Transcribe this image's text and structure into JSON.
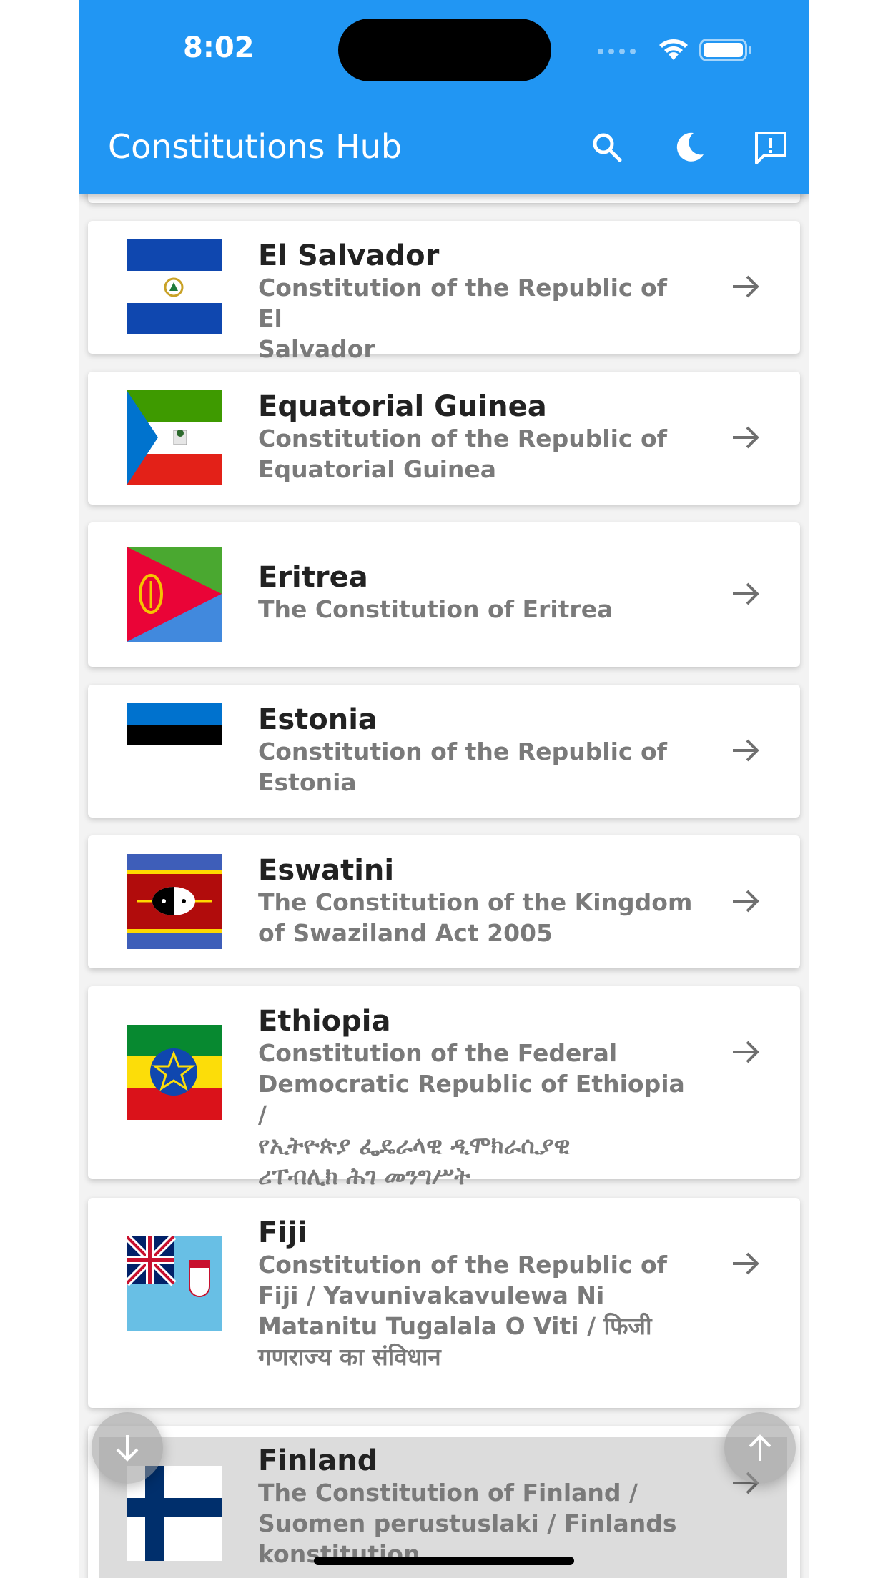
{
  "status": {
    "time": "8:02"
  },
  "appbar": {
    "title": "Constitutions Hub",
    "actions": [
      "search-icon",
      "moon-icon",
      "feedback-icon"
    ]
  },
  "colors": {
    "primary": "#2196f3",
    "card": "#ffffff",
    "subtitle": "#7a7a7a"
  },
  "countries": [
    {
      "name": "El Salvador",
      "lines": [
        "Constitution of the Republic of El",
        "Salvador"
      ]
    },
    {
      "name": "Equatorial Guinea",
      "lines": [
        "Constitution of the Republic of",
        "Equatorial Guinea"
      ]
    },
    {
      "name": "Eritrea",
      "lines": [
        "The Constitution of Eritrea"
      ]
    },
    {
      "name": "Estonia",
      "lines": [
        "Constitution of the Republic of",
        "Estonia"
      ]
    },
    {
      "name": "Eswatini",
      "lines": [
        "The Constitution of the Kingdom",
        "of Swaziland Act 2005"
      ]
    },
    {
      "name": "Ethiopia",
      "lines": [
        "Constitution of the Federal",
        "Democratic Republic of Ethiopia /",
        "የኢትዮጵያ ፌዴራላዊ ዲሞክራሲያዊ",
        "ሪፐብሊክ ሕገ መንግሥት"
      ]
    },
    {
      "name": "Fiji",
      "lines": [
        "Constitution of the Republic of",
        "Fiji / Yavunivakavulewa Ni",
        "Matanitu Tugalala O Viti / फिजी",
        "गणराज्य का संविधान"
      ]
    },
    {
      "name": "Finland",
      "lines": [
        "The Constitution of Finland /",
        "Suomen perustuslaki / Finlands",
        "konstitution"
      ]
    }
  ],
  "fabs": [
    "arrow-down-icon",
    "arrow-up-icon"
  ]
}
